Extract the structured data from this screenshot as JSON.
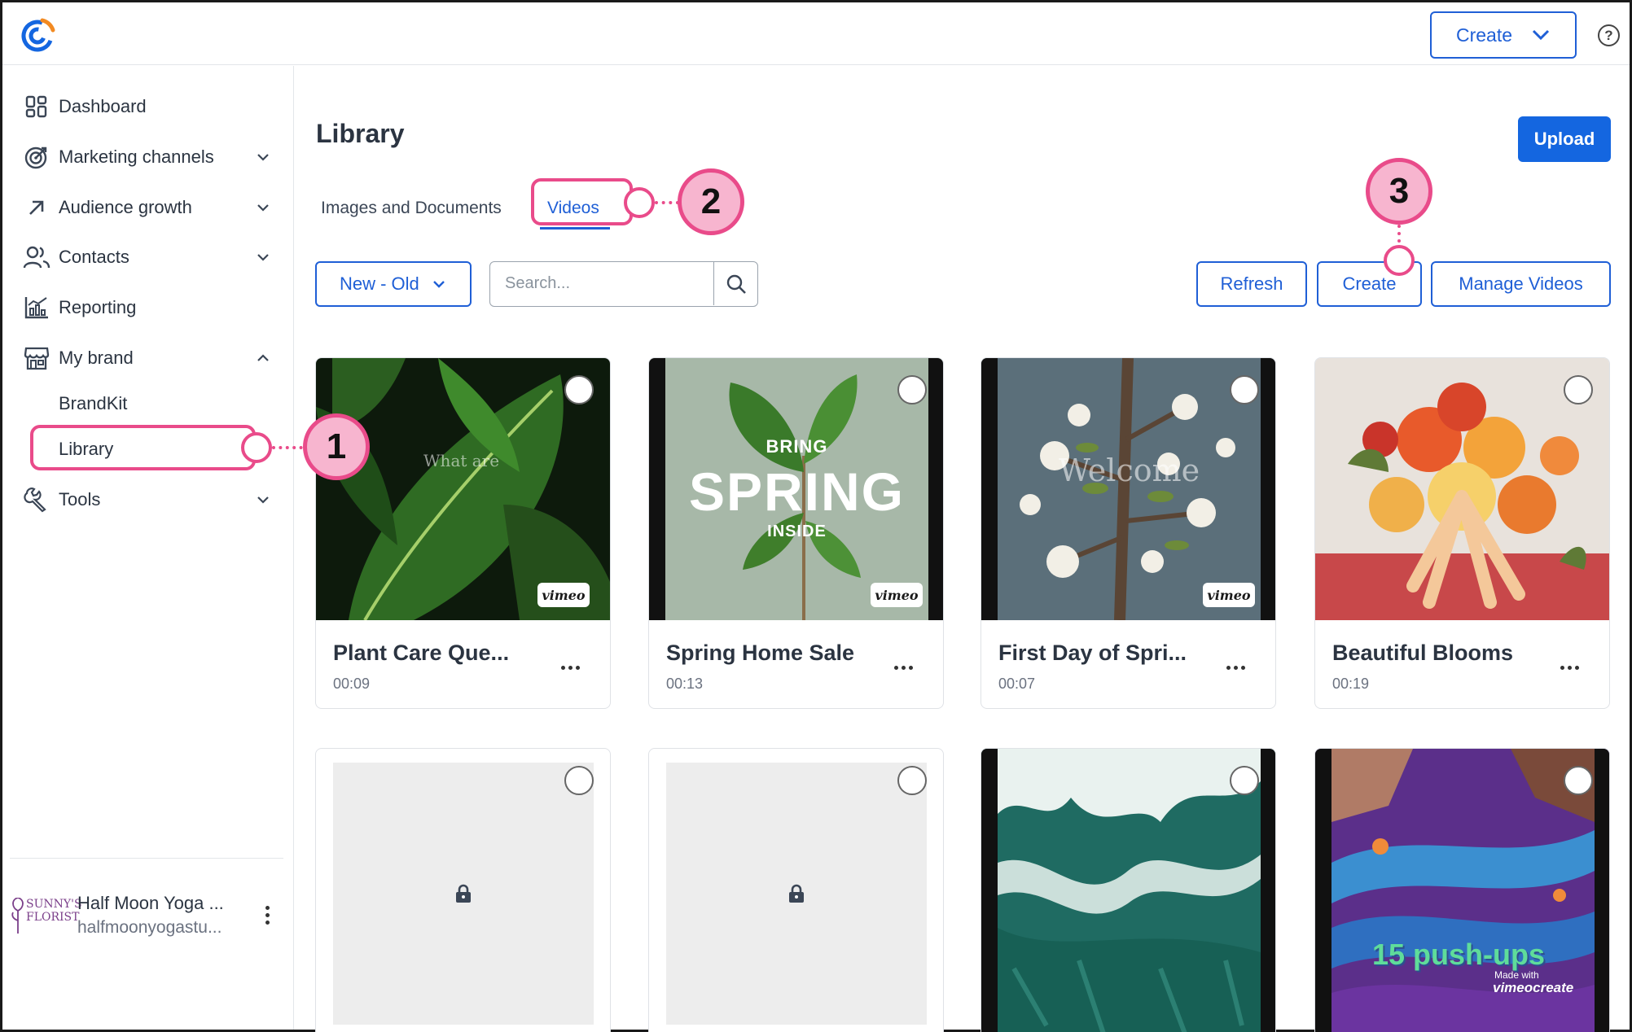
{
  "header": {
    "create_label": "Create",
    "help_glyph": "?",
    "icons": [
      "brand-logo-icon",
      "chevron-down-icon",
      "help-icon"
    ]
  },
  "sidebar": {
    "items": [
      {
        "label": "Dashboard",
        "icon": "dashboard-icon"
      },
      {
        "label": "Marketing channels",
        "icon": "target-icon"
      },
      {
        "label": "Audience growth",
        "icon": "arrow-up-right-icon"
      },
      {
        "label": "Contacts",
        "icon": "people-icon"
      },
      {
        "label": "Reporting",
        "icon": "chart-icon"
      },
      {
        "label": "My brand",
        "icon": "store-icon"
      },
      {
        "label": "Tools",
        "icon": "wrench-icon"
      }
    ],
    "sub_items": [
      {
        "label": "BrandKit"
      },
      {
        "label": "Library"
      }
    ],
    "account": {
      "logo_text": "SUNNY'S FLORIST",
      "name": "Half Moon Yoga ...",
      "email": "halfmoonyogastu..."
    }
  },
  "main": {
    "title": "Library",
    "upload_label": "Upload",
    "tabs": [
      {
        "label": "Images and Documents"
      },
      {
        "label": "Videos"
      }
    ],
    "sort_label": "New - Old",
    "search_placeholder": "Search...",
    "buttons": {
      "refresh": "Refresh",
      "create": "Create",
      "manage": "Manage Videos"
    },
    "cards": [
      {
        "title": "Plant Care Que...",
        "duration": "00:09",
        "overlay": "What are",
        "badge": "vimeo"
      },
      {
        "title": "Spring Home Sale",
        "duration": "00:13",
        "overlay_top": "BRING",
        "overlay_main": "SPRING",
        "overlay_bottom": "INSIDE",
        "badge": "vimeo"
      },
      {
        "title": "First Day of Spri...",
        "duration": "00:07",
        "overlay": "Welcome",
        "badge": "vimeo"
      },
      {
        "title": "Beautiful Blooms",
        "duration": "00:19"
      },
      {
        "locked": true
      },
      {
        "locked": true
      },
      {
        "theme": "ocean"
      },
      {
        "overlay": "15 push-ups",
        "made_with": "Made with",
        "made_with_brand": "vimeocreate"
      }
    ]
  },
  "callouts": [
    "1",
    "2",
    "3"
  ],
  "colors": {
    "accent": "#1f5fd6",
    "primary_button": "#1466e0",
    "callout": "#e94b8a",
    "callout_fill": "#f7b5cf"
  }
}
